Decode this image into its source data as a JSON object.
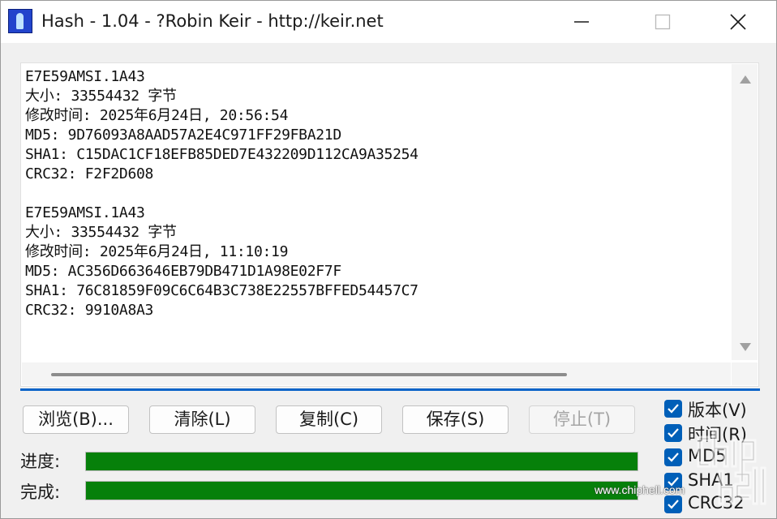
{
  "window": {
    "title": "Hash - 1.04 - ?Robin Keir - http://keir.net"
  },
  "output": {
    "lines": [
      "E7E59AMSI.1A43",
      "大小: 33554432 字节",
      "修改时间: 2025年6月24日, 20:56:54",
      "MD5: 9D76093A8AAD57A2E4C971FF29FBA21D",
      "SHA1: C15DAC1CF18EFB85DED7E432209D112CA9A35254",
      "CRC32: F2F2D608",
      "",
      "E7E59AMSI.1A43",
      "大小: 33554432 字节",
      "修改时间: 2025年6月24日, 11:10:19",
      "MD5: AC356D663646EB79DB471D1A98E02F7F",
      "SHA1: 76C81859F09C6C64B3C738E22557BFFED54457C7",
      "CRC32: 9910A8A3"
    ]
  },
  "buttons": {
    "browse": "浏览(B)...",
    "clear": "清除(L)",
    "copy": "复制(C)",
    "save": "保存(S)",
    "stop": "停止(T)"
  },
  "options": [
    {
      "label": "版本(V)",
      "checked": true
    },
    {
      "label": "时间(R)",
      "checked": true
    },
    {
      "label": "MD5",
      "checked": true
    },
    {
      "label": "SHA1",
      "checked": true
    },
    {
      "label": "CRC32",
      "checked": true
    }
  ],
  "progress": {
    "progress_label": "进度:",
    "complete_label": "完成:",
    "progress_value": 1.0,
    "complete_value": 1.0
  },
  "watermark": {
    "text": "www.chiphell.com"
  },
  "colors": {
    "accent": "#005fb8",
    "progress_fill": "#06800a",
    "separator": "#0a64c8"
  }
}
